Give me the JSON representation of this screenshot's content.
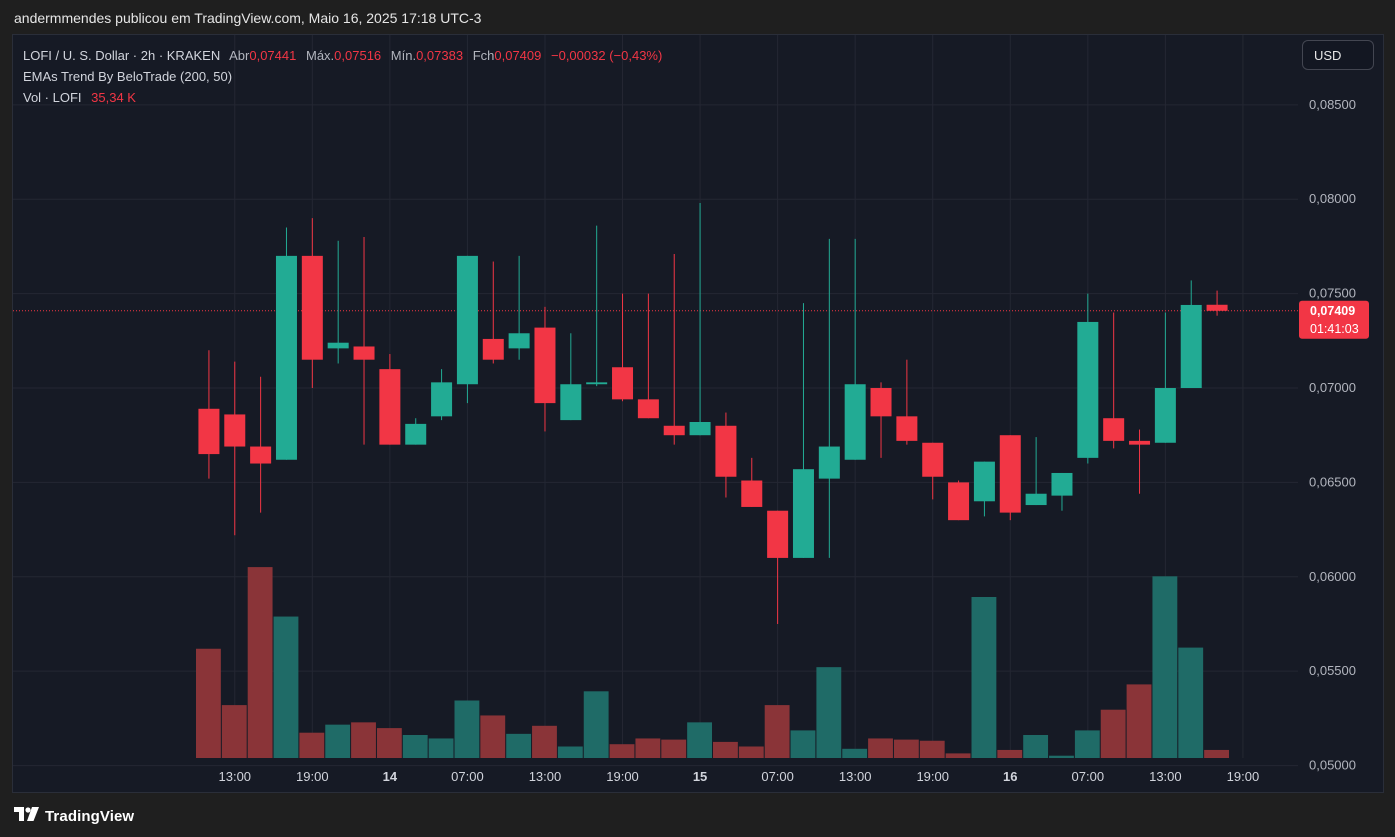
{
  "header": {
    "publish_line": "andermmendes publicou em TradingView.com, Maio 16, 2025 17:18 UTC-3"
  },
  "legend": {
    "symbol": "LOFI / U. S. Dollar · 2h · KRAKEN",
    "open_label": "Abr",
    "open_value": "0,07441",
    "high_label": "Máx.",
    "high_value": "0,07516",
    "low_label": "Mín.",
    "low_value": "0,07383",
    "close_label": "Fch",
    "close_value": "0,07409",
    "change": "−0,00032 (−0,43%)",
    "indicator": "EMAs Trend By BeloTrade (200, 50)",
    "volume_label": "Vol · LOFI",
    "volume_value": "35,34 K"
  },
  "currency_button": {
    "label": "USD"
  },
  "price_tag": {
    "price": "0,07409",
    "countdown": "01:41:03"
  },
  "footer": {
    "brand": "TradingView"
  },
  "colors": {
    "up": "#22ab94",
    "down": "#f23645",
    "vol_up": "#1f6b67",
    "vol_down": "#8a3438",
    "grid": "#242733",
    "background": "#161a25"
  },
  "chart_data": {
    "type": "candlestick",
    "price_axis": {
      "ticks": [
        "0,08500",
        "0,08000",
        "0,07500",
        "0,07000",
        "0,06500",
        "0,06000",
        "0,05500",
        "0,05000"
      ],
      "tick_values": [
        0.085,
        0.08,
        0.075,
        0.07,
        0.065,
        0.06,
        0.055,
        0.05
      ],
      "range": [
        0.0486,
        0.0887
      ]
    },
    "time_axis": {
      "labels": [
        "13:00",
        "19:00",
        "14",
        "07:00",
        "13:00",
        "19:00",
        "15",
        "07:00",
        "13:00",
        "19:00",
        "16",
        "07:00",
        "13:00",
        "19:00"
      ],
      "bold": [
        false,
        false,
        true,
        false,
        false,
        false,
        true,
        false,
        false,
        false,
        true,
        false,
        false,
        false
      ],
      "label_bar_index": [
        1.5,
        4.5,
        7.5,
        10.5,
        13.5,
        16.5,
        19.5,
        22.5,
        25.5,
        28.5,
        31.5,
        34.5,
        37.5,
        40.5
      ]
    },
    "last_price": 0.07409,
    "candles": [
      {
        "o": 0.0689,
        "h": 0.072,
        "l": 0.0652,
        "c": 0.0665,
        "v": 0.00475
      },
      {
        "o": 0.0686,
        "h": 0.0714,
        "l": 0.0622,
        "c": 0.0669,
        "v": 0.0023
      },
      {
        "o": 0.0669,
        "h": 0.0706,
        "l": 0.0634,
        "c": 0.066,
        "v": 0.0083
      },
      {
        "o": 0.0662,
        "h": 0.0785,
        "l": 0.0662,
        "c": 0.077,
        "v": 0.00615
      },
      {
        "o": 0.077,
        "h": 0.079,
        "l": 0.07,
        "c": 0.0715,
        "v": 0.0011
      },
      {
        "o": 0.0721,
        "h": 0.0778,
        "l": 0.0713,
        "c": 0.0724,
        "v": 0.00145
      },
      {
        "o": 0.0722,
        "h": 0.078,
        "l": 0.067,
        "c": 0.0715,
        "v": 0.00155
      },
      {
        "o": 0.071,
        "h": 0.0718,
        "l": 0.067,
        "c": 0.067,
        "v": 0.0013
      },
      {
        "o": 0.067,
        "h": 0.0684,
        "l": 0.067,
        "c": 0.0681,
        "v": 0.001
      },
      {
        "o": 0.0685,
        "h": 0.071,
        "l": 0.0683,
        "c": 0.0703,
        "v": 0.00085
      },
      {
        "o": 0.0702,
        "h": 0.077,
        "l": 0.0692,
        "c": 0.077,
        "v": 0.0025
      },
      {
        "o": 0.0726,
        "h": 0.0767,
        "l": 0.0713,
        "c": 0.0715,
        "v": 0.00185
      },
      {
        "o": 0.0721,
        "h": 0.077,
        "l": 0.0715,
        "c": 0.0729,
        "v": 0.00105
      },
      {
        "o": 0.0732,
        "h": 0.0743,
        "l": 0.0677,
        "c": 0.0692,
        "v": 0.0014
      },
      {
        "o": 0.0683,
        "h": 0.0729,
        "l": 0.0683,
        "c": 0.0702,
        "v": 0.0005
      },
      {
        "o": 0.0702,
        "h": 0.0786,
        "l": 0.0701,
        "c": 0.0703,
        "v": 0.0029
      },
      {
        "o": 0.0711,
        "h": 0.075,
        "l": 0.0693,
        "c": 0.0694,
        "v": 0.0006
      },
      {
        "o": 0.0694,
        "h": 0.075,
        "l": 0.0684,
        "c": 0.0684,
        "v": 0.00085
      },
      {
        "o": 0.068,
        "h": 0.0771,
        "l": 0.067,
        "c": 0.0675,
        "v": 0.0008
      },
      {
        "o": 0.0675,
        "h": 0.0798,
        "l": 0.0675,
        "c": 0.0682,
        "v": 0.00155
      },
      {
        "o": 0.068,
        "h": 0.0687,
        "l": 0.0642,
        "c": 0.0653,
        "v": 0.0007
      },
      {
        "o": 0.0651,
        "h": 0.0663,
        "l": 0.0637,
        "c": 0.0637,
        "v": 0.0005
      },
      {
        "o": 0.0635,
        "h": 0.0635,
        "l": 0.0575,
        "c": 0.061,
        "v": 0.0023
      },
      {
        "o": 0.061,
        "h": 0.0745,
        "l": 0.061,
        "c": 0.0657,
        "v": 0.0012
      },
      {
        "o": 0.0652,
        "h": 0.0779,
        "l": 0.061,
        "c": 0.0669,
        "v": 0.00395
      },
      {
        "o": 0.0662,
        "h": 0.0779,
        "l": 0.0662,
        "c": 0.0702,
        "v": 0.0004
      },
      {
        "o": 0.07,
        "h": 0.0703,
        "l": 0.0663,
        "c": 0.0685,
        "v": 0.00085
      },
      {
        "o": 0.0685,
        "h": 0.0715,
        "l": 0.067,
        "c": 0.0672,
        "v": 0.0008
      },
      {
        "o": 0.0671,
        "h": 0.0671,
        "l": 0.0641,
        "c": 0.0653,
        "v": 0.00075
      },
      {
        "o": 0.065,
        "h": 0.0651,
        "l": 0.063,
        "c": 0.063,
        "v": 0.0002
      },
      {
        "o": 0.064,
        "h": 0.0661,
        "l": 0.0632,
        "c": 0.0661,
        "v": 0.007
      },
      {
        "o": 0.0675,
        "h": 0.0675,
        "l": 0.063,
        "c": 0.0634,
        "v": 0.00035
      },
      {
        "o": 0.0638,
        "h": 0.0674,
        "l": 0.0638,
        "c": 0.0644,
        "v": 0.001
      },
      {
        "o": 0.0643,
        "h": 0.0655,
        "l": 0.0635,
        "c": 0.0655,
        "v": 0.0001
      },
      {
        "o": 0.0663,
        "h": 0.075,
        "l": 0.066,
        "c": 0.0735,
        "v": 0.0012
      },
      {
        "o": 0.0684,
        "h": 0.074,
        "l": 0.0668,
        "c": 0.0672,
        "v": 0.0021
      },
      {
        "o": 0.0672,
        "h": 0.0678,
        "l": 0.0644,
        "c": 0.067,
        "v": 0.0032
      },
      {
        "o": 0.0671,
        "h": 0.074,
        "l": 0.0671,
        "c": 0.07,
        "v": 0.0079
      },
      {
        "o": 0.07,
        "h": 0.0757,
        "l": 0.07,
        "c": 0.0744,
        "v": 0.0048
      },
      {
        "o": 0.07441,
        "h": 0.07516,
        "l": 0.07383,
        "c": 0.07409,
        "v": 0.00035
      }
    ]
  }
}
